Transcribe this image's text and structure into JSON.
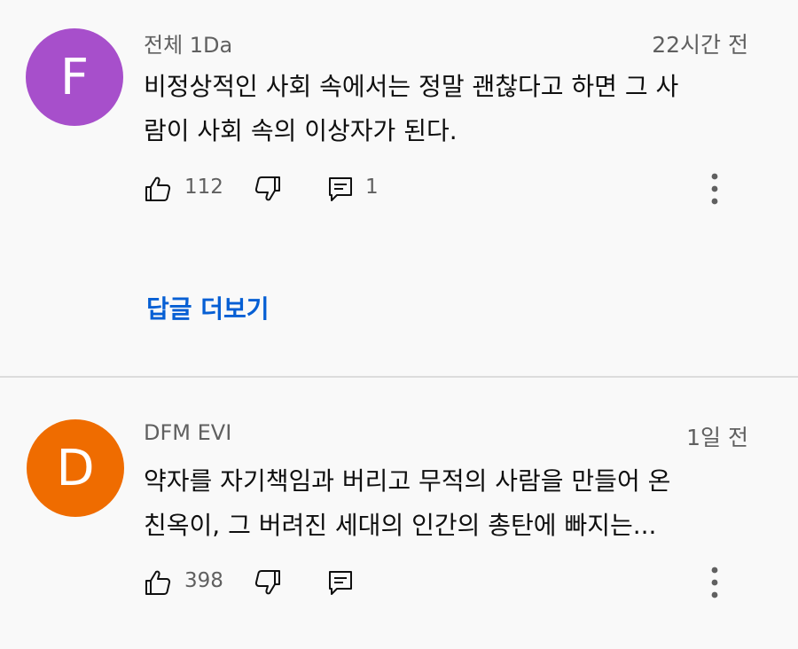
{
  "comments": [
    {
      "avatar_letter": "F",
      "avatar_color": "#a74fcb",
      "author": "전체 1Da",
      "time": "22시간 전",
      "text_lines": [
        "비정상적인 사회 속에서는 정말 괜찮다고 하면 그 사",
        "람이 사회 속의 이상자가 된다."
      ],
      "like_count": "112",
      "reply_count": "1",
      "replies_link": "답글 더보기"
    },
    {
      "avatar_letter": "D",
      "avatar_color": "#ef6c00",
      "author": "DFM EVI",
      "time": "1일 전",
      "text_lines": [
        "약자를 자기책임과 버리고 무적의 사람을 만들어 온",
        "친옥이, 그 버려진 세대의 인간의 총탄에 빠지는..."
      ],
      "like_count": "398"
    }
  ],
  "icons": {
    "like": "thumbs-up-icon",
    "dislike": "thumbs-down-icon",
    "reply": "reply-comment-icon",
    "more": "more-vertical-icon"
  },
  "colors": {
    "background": "#f9f9f9",
    "link": "#065fd4",
    "secondary_text": "#606060",
    "divider": "#dcdcdc"
  }
}
